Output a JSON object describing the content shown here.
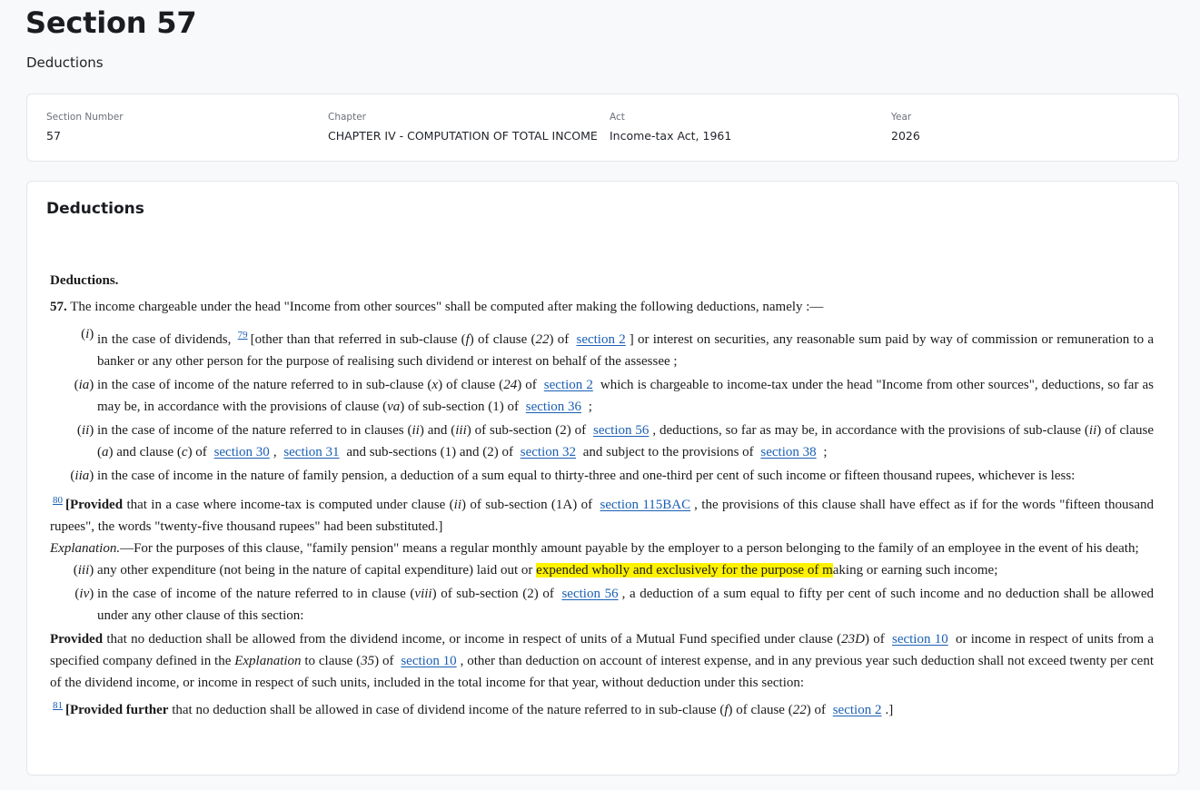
{
  "page": {
    "title": "Section 57",
    "subtitle": "Deductions"
  },
  "meta": [
    {
      "label": "Section Number",
      "value": "57"
    },
    {
      "label": "Chapter",
      "value": "CHAPTER IV - COMPUTATION OF TOTAL INCOME"
    },
    {
      "label": "Act",
      "value": "Income-tax Act, 1961"
    },
    {
      "label": "Year",
      "value": "2026"
    }
  ],
  "content": {
    "heading": "Deductions",
    "sec_title": "Deductions.",
    "sec_num": "57.",
    "intro": "The income chargeable under the head \"Income from other sources\" shall be computed after making the following deductions, namely :—",
    "links": {
      "section_2": "section 2",
      "section_36": "section 36",
      "section_56": "section 56",
      "section_30": "section 30",
      "section_31": "section 31",
      "section_32": "section 32",
      "section_38": "section 38",
      "section_115BAC": "section 115BAC",
      "section_10": "section 10"
    },
    "footnotes": {
      "f79": "79",
      "f80": "80",
      "f81": "81"
    },
    "clause_i": {
      "num_a": "(",
      "num_i": "i",
      "num_b": ")",
      "t1": "in the case of dividends,",
      "t2": "[other than that referred in sub-clause (",
      "t2i": "f",
      "t3": ") of clause (",
      "t3i": "22",
      "t4": ") of",
      "t5": "] or interest on securities, any reasonable sum paid by way of commission or remuneration to a banker or any other person for the purpose of realising such dividend or interest on behalf of the assessee ;"
    },
    "clause_ia": {
      "num_i": "ia",
      "t1": "in the case of income of the nature referred to in sub-clause (",
      "t1i": "x",
      "t2": ") of clause (",
      "t2i": "24",
      "t3": ") of",
      "t4": "which is chargeable to income-tax under the head \"Income from other sources\", deductions, so far as may be, in accordance with the provisions of clause (",
      "t4i": "va",
      "t5": ") of sub-section (1) of",
      "t6": ";"
    },
    "clause_ii": {
      "num_i": "ii",
      "t1": "in the case of income of the nature referred to in clauses (",
      "t1i": "ii",
      "t2": ") and (",
      "t2i": "iii",
      "t3": ") of sub-section (2) of",
      "t4": ", deductions, so far as may be, in accordance with the provisions of sub-clause (",
      "t4i": "ii",
      "t5": ") of clause (",
      "t5i": "a",
      "t6": ") and clause (",
      "t6i": "c",
      "t7": ") of",
      "t8": ",",
      "t9": "and sub-sections (1) and (2) of",
      "t10": "and subject to the provisions of",
      "t11": ";"
    },
    "clause_iia": {
      "num_i": "iia",
      "t1": "in the case of income in the nature of family pension, a deduction of a sum equal to thirty-three and one-third per cent of such income or fifteen thousand rupees, whichever is less:",
      "p_b": "[Provided",
      "p1": "that in a case where income-tax is computed under clause (",
      "p1i": "ii",
      "p2": ") of sub-section (1A) of",
      "p3": ", the provisions of this clause shall have effect as if for the words \"fifteen thousand rupees\", the words \"twenty-five thousand rupees\" had been substituted.]",
      "expl_i": "Explanation.",
      "expl": "—For the purposes of this clause, \"family pension\" means a regular monthly amount payable by the employer to a person belonging to the family of an employee in the event of his death;"
    },
    "clause_iii": {
      "num_i": "iii",
      "t1": "any other expenditure (not being in the nature of capital expenditure) laid out or",
      "hl_a": "expended wholly and exclusively for the purpose of m",
      "t2": "aking or earning such income;"
    },
    "clause_iv": {
      "num_i": "iv",
      "t1": "in the case of income of the nature referred to in clause (",
      "t1i": "viii",
      "t2": ") of sub-section (2) of",
      "t3": ", a deduction of a sum equal to fifty per cent of such income and no deduction shall be allowed under any other clause of this section:"
    },
    "proviso1": {
      "b": "Provided",
      "t1": "that no deduction shall be allowed from the dividend income, or income in respect of units of a Mutual Fund specified under clause (",
      "t1i": "23D",
      "t2": ") of",
      "t3": "or income in respect of units from a specified company defined in the",
      "t3i": "Explanation",
      "t4": "to clause (",
      "t4i": "35",
      "t5": ") of",
      "t6": ", other than deduction on account of interest expense, and in any previous year such deduction shall not exceed twenty per cent of the dividend income, or income in respect of such units, included in the total income for that year, without deduction under this section:"
    },
    "proviso2": {
      "b": "[Provided further",
      "t1": "that no deduction shall be allowed in case of dividend income of the nature referred to in sub-clause (",
      "t1i": "f",
      "t2": ") of clause (",
      "t2i": "22",
      "t3": ") of",
      "t4": ".]"
    }
  }
}
